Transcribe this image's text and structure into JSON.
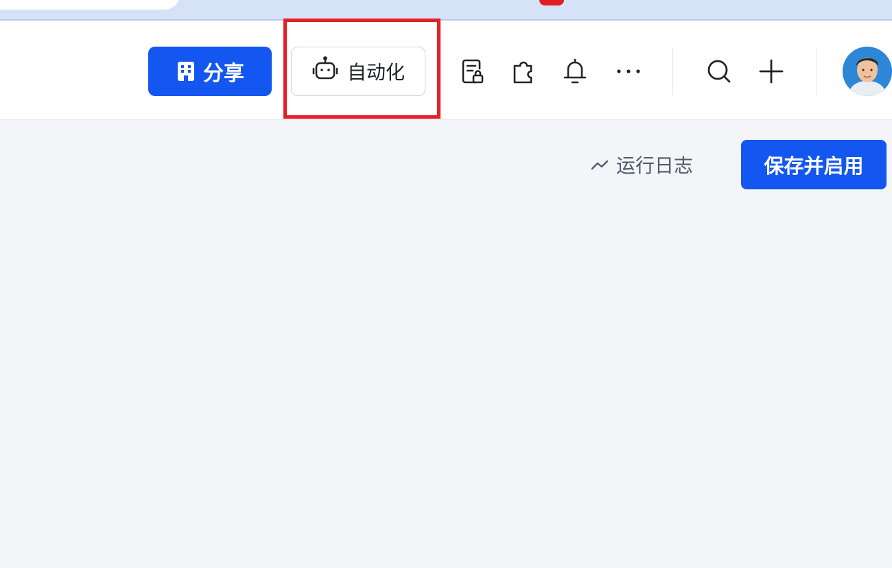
{
  "header": {
    "share_label": "分享",
    "automation_label": "自动化",
    "icons": [
      "file-lock-icon",
      "puzzle-icon",
      "bell-icon",
      "more-icon",
      "search-icon",
      "plus-icon"
    ]
  },
  "toolbar": {
    "run_log_label": "运行日志",
    "save_enable_label": "保存并启用"
  },
  "colors": {
    "primary": "#1456f0",
    "highlight": "#e41f26",
    "background": "#f3f5f9"
  }
}
